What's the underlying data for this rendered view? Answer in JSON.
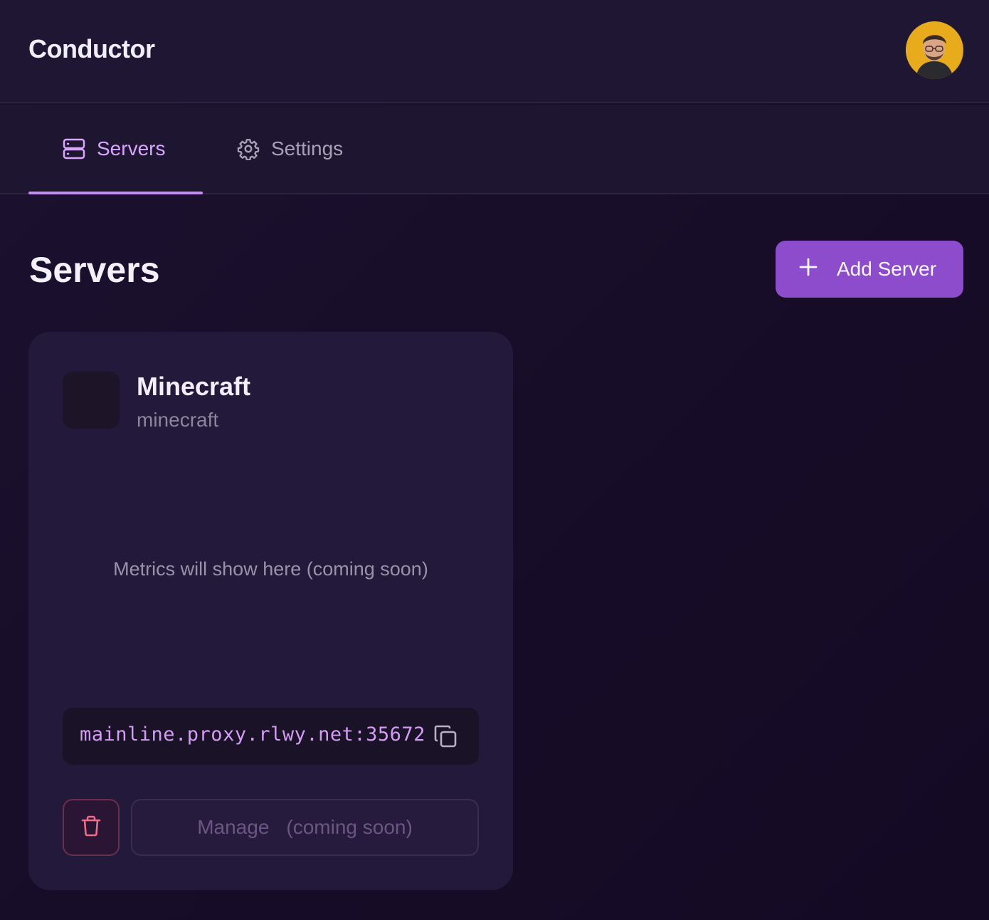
{
  "header": {
    "app_title": "Conductor"
  },
  "tabs": [
    {
      "label": "Servers",
      "icon": "server-icon",
      "active": true
    },
    {
      "label": "Settings",
      "icon": "gear-icon",
      "active": false
    }
  ],
  "main": {
    "title": "Servers",
    "add_button_label": "Add Server"
  },
  "server_card": {
    "name": "Minecraft",
    "game": "minecraft",
    "metrics_placeholder": "Metrics will show here (coming soon)",
    "address": "mainline.proxy.rlwy.net:35672",
    "manage_label": "Manage",
    "manage_suffix": "(coming soon)"
  },
  "colors": {
    "accent": "#8d4ccc",
    "active_tab": "#d9a6ff",
    "danger": "#f06a8a",
    "address_text": "#d59cf5"
  }
}
